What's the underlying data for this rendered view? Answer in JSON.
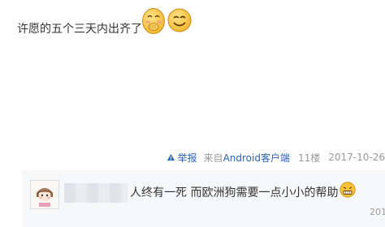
{
  "post": {
    "text": "许愿的五个三天内出齐了",
    "emojis": [
      "shy-covering-mouth-emoji",
      "grinning-smile-emoji"
    ]
  },
  "tail": {
    "report_label": "举报",
    "client_prefix": "来自",
    "client_name": "Android客户端",
    "floor": "11楼",
    "date": "2017-10-26"
  },
  "subfloor": {
    "reply_text": "人终有一死 而欧洲狗需要一点小小的帮助",
    "reply_emoji": "grimace-emoji",
    "date_partial": "201"
  },
  "colors": {
    "link": "#2d64b3",
    "muted": "#999999",
    "text": "#333333",
    "subfloor_bg": "#f7f8fa",
    "emoji_yellow": "#f6c33a"
  }
}
